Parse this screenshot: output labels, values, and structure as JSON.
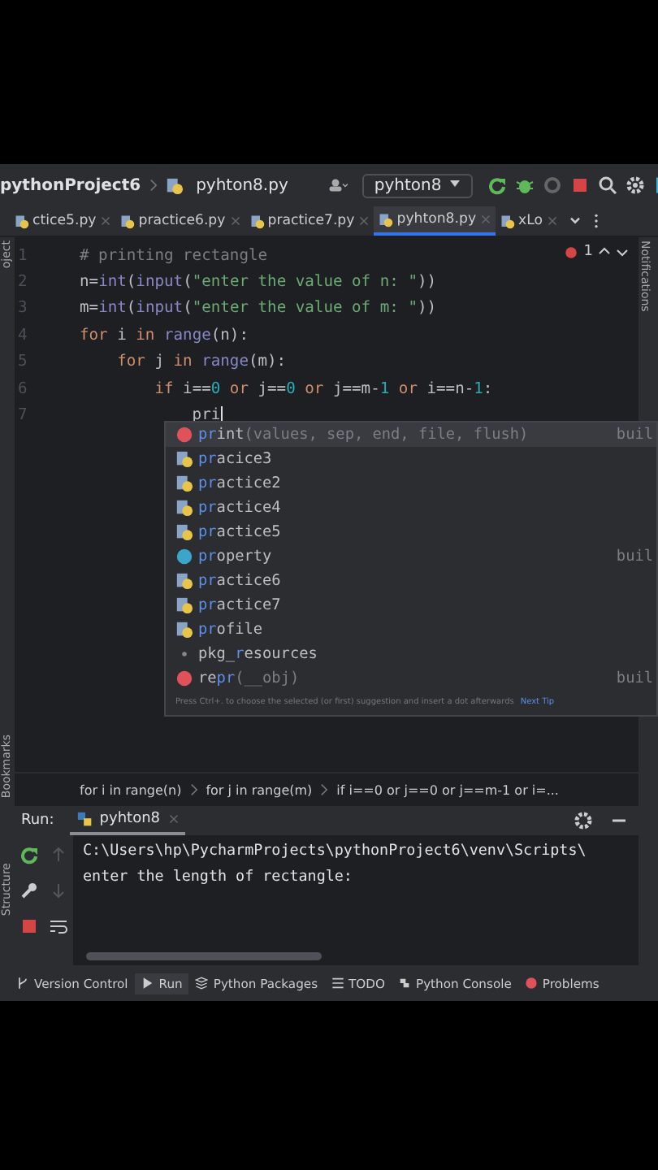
{
  "navbar": {
    "project": "pythonProject6",
    "file": "pyhton8.py",
    "run_config": "pyhton8"
  },
  "tabs": [
    {
      "label": "ctice5.py",
      "selected": false
    },
    {
      "label": "practice6.py",
      "selected": false
    },
    {
      "label": "practice7.py",
      "selected": false
    },
    {
      "label": "pyhton8.py",
      "selected": true
    },
    {
      "label": "xLo",
      "selected": false
    }
  ],
  "side_labels": {
    "left": [
      "oject",
      "Bookmarks",
      "Structure"
    ],
    "right": "Notifications"
  },
  "error_count": "1",
  "code_lines": [
    {
      "number": "1",
      "tokens": [
        {
          "kind": "comment",
          "text": "# printing rectangle"
        }
      ]
    },
    {
      "number": "2",
      "tokens": [
        {
          "kind": "plain",
          "text": "n="
        },
        {
          "kind": "builtin",
          "text": "int"
        },
        {
          "kind": "plain",
          "text": "("
        },
        {
          "kind": "builtin",
          "text": "input"
        },
        {
          "kind": "plain",
          "text": "("
        },
        {
          "kind": "string",
          "text": "\"enter the value of n: \""
        },
        {
          "kind": "plain",
          "text": "))"
        }
      ]
    },
    {
      "number": "3",
      "tokens": [
        {
          "kind": "plain",
          "text": "m="
        },
        {
          "kind": "builtin",
          "text": "int"
        },
        {
          "kind": "plain",
          "text": "("
        },
        {
          "kind": "builtin",
          "text": "input"
        },
        {
          "kind": "plain",
          "text": "("
        },
        {
          "kind": "string",
          "text": "\"enter the value of m: \""
        },
        {
          "kind": "plain",
          "text": "))"
        }
      ]
    },
    {
      "number": "4",
      "tokens": [
        {
          "kind": "keyword",
          "text": "for"
        },
        {
          "kind": "plain",
          "text": " i "
        },
        {
          "kind": "keyword",
          "text": "in"
        },
        {
          "kind": "builtin",
          "text": " range"
        },
        {
          "kind": "plain",
          "text": "(n):"
        }
      ]
    },
    {
      "number": "5",
      "tokens": [
        {
          "kind": "keyword",
          "text": "    for"
        },
        {
          "kind": "plain",
          "text": " j "
        },
        {
          "kind": "keyword",
          "text": "in"
        },
        {
          "kind": "builtin",
          "text": " range"
        },
        {
          "kind": "plain",
          "text": "(m):"
        }
      ]
    },
    {
      "number": "6",
      "tokens": [
        {
          "kind": "keyword",
          "text": "        if"
        },
        {
          "kind": "plain",
          "text": " i=="
        },
        {
          "kind": "number",
          "text": "0"
        },
        {
          "kind": "keyword",
          "text": " or"
        },
        {
          "kind": "plain",
          "text": " j=="
        },
        {
          "kind": "number",
          "text": "0"
        },
        {
          "kind": "keyword",
          "text": " or"
        },
        {
          "kind": "plain",
          "text": " j==m-"
        },
        {
          "kind": "number",
          "text": "1"
        },
        {
          "kind": "keyword",
          "text": " or"
        },
        {
          "kind": "plain",
          "text": " i==n-"
        },
        {
          "kind": "number",
          "text": "1"
        },
        {
          "kind": "plain",
          "text": ":"
        }
      ]
    },
    {
      "number": "7",
      "tokens": [
        {
          "kind": "plain",
          "text": "            pri"
        }
      ]
    }
  ],
  "completion": {
    "items": [
      {
        "kind": "function",
        "match": "pr",
        "after": "int",
        "params": "(values, sep, end, file, flush)",
        "source": "buil",
        "selected": true
      },
      {
        "kind": "module",
        "match": "pr",
        "after": "acice3",
        "selected": false
      },
      {
        "kind": "module",
        "match": "pr",
        "after": "actice2",
        "selected": false
      },
      {
        "kind": "module",
        "match": "pr",
        "after": "actice4",
        "selected": false
      },
      {
        "kind": "module",
        "match": "pr",
        "after": "actice5",
        "selected": false
      },
      {
        "kind": "class",
        "match": "pr",
        "after": "operty",
        "source": "buil",
        "selected": false
      },
      {
        "kind": "module",
        "match": "pr",
        "after": "actice6",
        "selected": false
      },
      {
        "kind": "module",
        "match": "pr",
        "after": "actice7",
        "selected": false
      },
      {
        "kind": "module",
        "match": "pr",
        "after": "ofile",
        "selected": false
      },
      {
        "kind": "package",
        "before": "pkg_",
        "match": "r",
        "after": "esources",
        "selected": false
      },
      {
        "kind": "function",
        "before": "re",
        "match": "pr",
        "params": "(__obj)",
        "source": "buil",
        "selected": false
      }
    ],
    "tip": "Press Ctrl+. to choose the selected (or first) suggestion and insert a dot afterwards",
    "next_tip": "Next Tip"
  },
  "breadcrumbs": [
    "for i in range(n)",
    "for j in range(m)",
    "if i==0 or j==0 or j==m-1 or i=..."
  ],
  "run_panel": {
    "label": "Run:",
    "tab": "pyhton8",
    "output": [
      "C:\\Users\\hp\\PycharmProjects\\pythonProject6\\venv\\Scripts\\",
      "enter the length of rectangle:"
    ]
  },
  "tool_windows": [
    {
      "label": "Version Control",
      "kind": "branch",
      "selected": false
    },
    {
      "label": "Run",
      "kind": "run",
      "selected": true
    },
    {
      "label": "Python Packages",
      "kind": "stack",
      "selected": false
    },
    {
      "label": "TODO",
      "kind": "list",
      "selected": false
    },
    {
      "label": "Python Console",
      "kind": "python",
      "selected": false
    },
    {
      "label": "Problems",
      "kind": "error",
      "selected": false
    }
  ]
}
